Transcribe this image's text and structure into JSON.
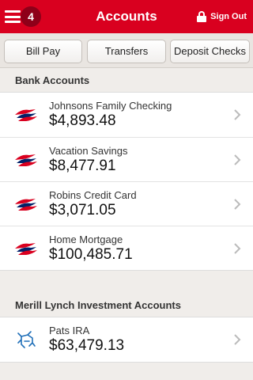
{
  "header": {
    "title": "Accounts",
    "menu_icon": "hamburger-icon",
    "notification_count": "4",
    "sign_out_label": "Sign Out",
    "sign_out_icon": "lock-icon",
    "bar_color": "#d9001f"
  },
  "quick_actions": [
    {
      "label": "Bill Pay"
    },
    {
      "label": "Transfers"
    },
    {
      "label": "Deposit Checks"
    }
  ],
  "sections": [
    {
      "title": "Bank Accounts",
      "accounts": [
        {
          "name": "Johnsons Family Checking",
          "balance": "$4,893.48",
          "icon": "bank-flag-logo-icon"
        },
        {
          "name": "Vacation Savings",
          "balance": "$8,477.91",
          "icon": "bank-flag-logo-icon"
        },
        {
          "name": "Robins Credit Card",
          "balance": "$3,071.05",
          "icon": "bank-flag-logo-icon"
        },
        {
          "name": "Home Mortgage",
          "balance": "$100,485.71",
          "icon": "bank-flag-logo-icon"
        }
      ]
    },
    {
      "title": "Merill Lynch Investment Accounts",
      "accounts": [
        {
          "name": "Pats IRA",
          "balance": "$63,479.13",
          "icon": "bull-logo-icon"
        }
      ]
    }
  ]
}
